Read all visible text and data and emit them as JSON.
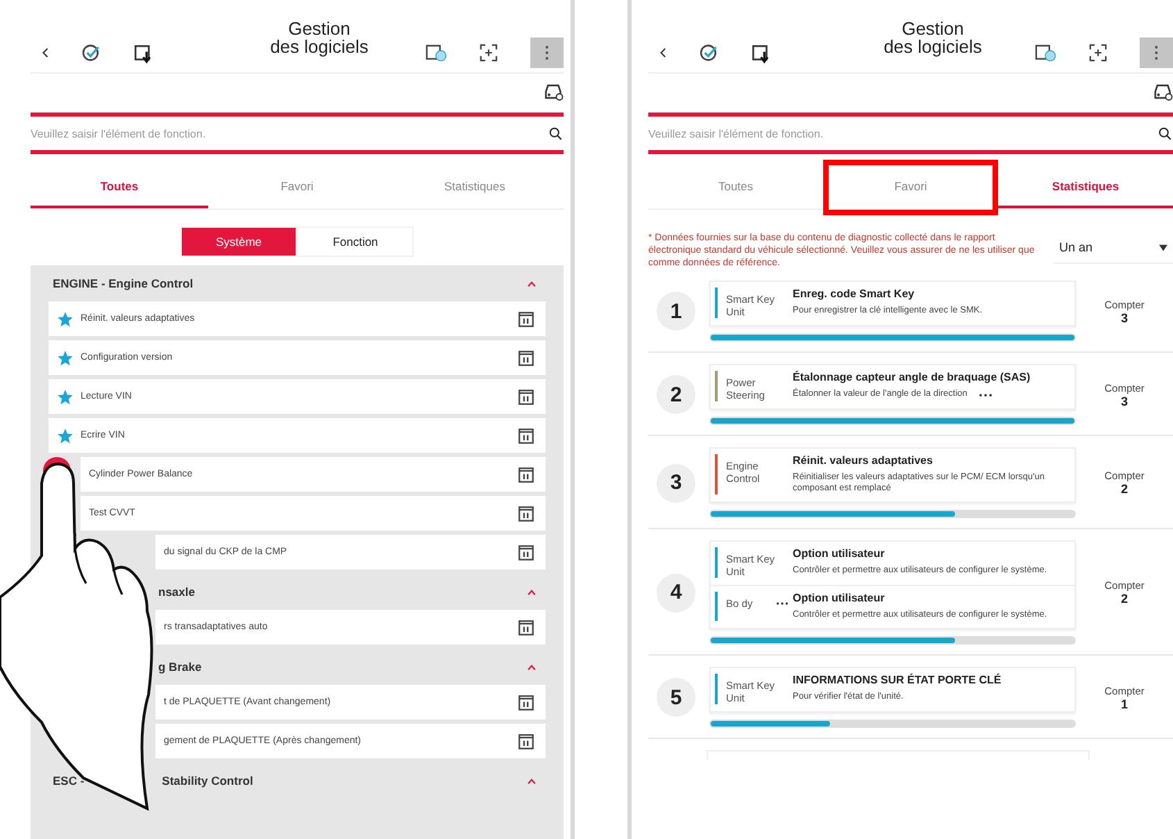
{
  "screens": [
    {
      "kind": "list",
      "title": [
        "Gestion",
        "des logiciels"
      ],
      "search": {
        "placeholder": "Veuillez saisir l'élément de fonction."
      },
      "tabs": [
        {
          "label": "Toutes",
          "selected": true,
          "highlighted": false
        },
        {
          "label": "Favori",
          "selected": false,
          "highlighted": false
        },
        {
          "label": "Statistiques",
          "selected": false,
          "highlighted": false
        }
      ],
      "segments": [
        {
          "label": "Système",
          "selected": true
        },
        {
          "label": "Fonction",
          "selected": false
        }
      ],
      "sections": [
        {
          "title_parts": [
            "ENGINE - Engine Control"
          ],
          "expanded": true,
          "items": [
            {
              "label": "Réinit. valeurs adaptatives",
              "favorite": true
            },
            {
              "label": "Configuration version",
              "favorite": true
            },
            {
              "label": "Lecture VIN",
              "favorite": true
            },
            {
              "label": "Ecrire VIN",
              "favorite": true
            },
            {
              "label": "Cylinder Power Balance",
              "favorite": false,
              "under_finger": true
            },
            {
              "label": "Test CVVT",
              "favorite": false,
              "under_finger": true
            },
            {
              "label": "du signal du CKP de la CMP",
              "favorite": false,
              "under_hand": true
            }
          ]
        },
        {
          "title_parts": [
            "nsaxle"
          ],
          "under_hand": true,
          "expanded": true,
          "items": [
            {
              "label": "rs transadaptatives auto",
              "favorite": false,
              "under_hand": true
            }
          ]
        },
        {
          "title_parts": [
            "g Brake"
          ],
          "under_hand": true,
          "expanded": true,
          "items": [
            {
              "label": "t de PLAQUETTE (Avant changement)",
              "favorite": false,
              "under_hand": true
            },
            {
              "label": "gement de PLAQUETTE (Après changement)",
              "favorite": false,
              "under_hand": true
            }
          ]
        },
        {
          "title_parts": [
            "ESC -",
            "Stability Control"
          ],
          "expanded": true
        }
      ]
    },
    {
      "kind": "stats",
      "title": [
        "Gestion",
        "des logiciels"
      ],
      "search": {
        "placeholder": "Veuillez saisir l'élément de fonction."
      },
      "tabs": [
        {
          "label": "Toutes",
          "selected": false,
          "highlighted": false
        },
        {
          "label": "Favori",
          "selected": false,
          "highlighted": true
        },
        {
          "label": "Statistiques",
          "selected": true,
          "highlighted": false
        }
      ],
      "notice": "* Données fournies sur la base du contenu de diagnostic collecté dans le rapport électronique standard du véhicule sélectionné. Veuillez vous assurer de ne les utiliser que comme données de référence.",
      "period": "Un an",
      "entries": [
        {
          "rank": "1",
          "count_label": "Compter",
          "count": "3",
          "level": 1.0,
          "functions": [
            {
              "system": "Smart Key Unit",
              "color": "#1aa6c8",
              "name": "Enreg. code Smart Key",
              "description": "Pour enregistrer la clé intelligente avec le SMK."
            }
          ]
        },
        {
          "rank": "2",
          "count_label": "Compter",
          "count": "3",
          "level": 1.0,
          "functions": [
            {
              "system": "Power Steering",
              "color": "#a89a78",
              "name": "Étalonnage capteur angle de braquage (SAS)",
              "description": "Étalonner la valeur de l'angle de la direction",
              "more": true
            }
          ]
        },
        {
          "rank": "3",
          "count_label": "Compter",
          "count": "2",
          "level": 0.67,
          "functions": [
            {
              "system": "Engine Control",
              "color": "#d9533a",
              "name": "Réinit. valeurs adaptatives",
              "description": "Réinitialiser les valeurs adaptatives sur le PCM/ ECM lorsqu'un composant est remplacé"
            }
          ]
        },
        {
          "rank": "4",
          "count_label": "Compter",
          "count": "2",
          "level": 0.67,
          "functions": [
            {
              "system": "Smart Key Unit",
              "color": "#1aa6c8",
              "name": "Option utilisateur",
              "description": "Contrôler et permettre aux utilisateurs de configurer le système."
            },
            {
              "system": "Bo dy",
              "color": "#1aa6c8",
              "name": "Option utilisateur",
              "description": "Contrôler et permettre aux utilisateurs de configurer le système.",
              "system_more": true
            }
          ]
        },
        {
          "rank": "5",
          "count_label": "Compter",
          "count": "1",
          "level": 0.33,
          "functions": [
            {
              "system": "Smart Key Unit",
              "color": "#1aa6c8",
              "name": "INFORMATIONS SUR ÉTAT PORTE CLÉ",
              "description": "Pour vérifier l'état de l'unité."
            }
          ]
        }
      ]
    }
  ]
}
